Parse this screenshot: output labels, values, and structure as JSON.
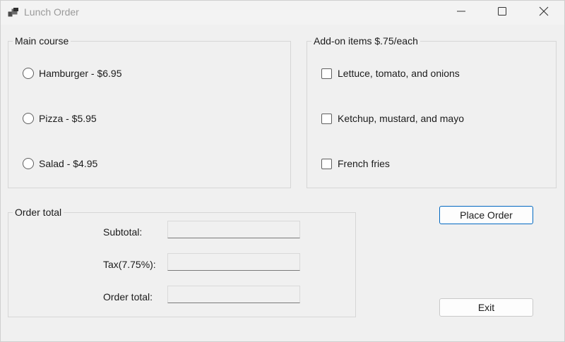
{
  "window": {
    "title": "Lunch Order",
    "icons": {
      "app": "app-window-icon",
      "minimize": "minimize-icon",
      "maximize": "maximize-icon",
      "close": "close-icon"
    }
  },
  "main_course": {
    "caption": "Main course",
    "options": [
      {
        "label": "Hamburger - $6.95",
        "selected": false
      },
      {
        "label": "Pizza - $5.95",
        "selected": false
      },
      {
        "label": "Salad - $4.95",
        "selected": false
      }
    ]
  },
  "add_ons": {
    "caption": "Add-on items $.75/each",
    "options": [
      {
        "label": "Lettuce, tomato, and onions",
        "checked": false
      },
      {
        "label": "Ketchup, mustard, and mayo",
        "checked": false
      },
      {
        "label": "French fries",
        "checked": false
      }
    ]
  },
  "order_total": {
    "caption": "Order total",
    "subtotal_label": "Subtotal:",
    "subtotal_value": "",
    "tax_label": "Tax(7.75%):",
    "tax_value": "",
    "total_label": "Order total:",
    "total_value": ""
  },
  "buttons": {
    "place_order": "Place Order",
    "exit": "Exit"
  },
  "colors": {
    "window_bg": "#f0f0f0",
    "accent": "#0067c0"
  }
}
